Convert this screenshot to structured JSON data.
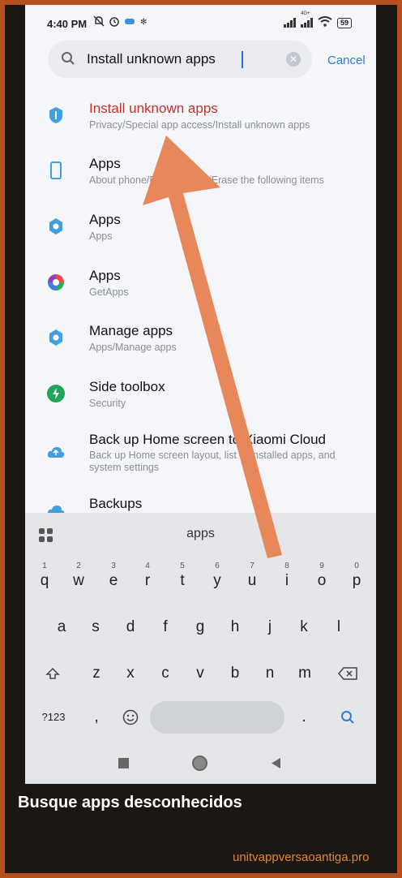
{
  "status_bar": {
    "time": "4:40 PM",
    "network_type": "4G+",
    "battery": "59"
  },
  "search": {
    "value": "Install unknown apps",
    "cancel_label": "Cancel"
  },
  "results": [
    {
      "title": "Install unknown apps",
      "subtitle": "Privacy/Special app access/Install unknown apps",
      "icon": "shield-icon",
      "color": "#3f9fe0"
    },
    {
      "title": "Apps",
      "subtitle": "About phone/Factory reset/Erase the following items",
      "icon": "phone-icon",
      "color": "#3f9fe0"
    },
    {
      "title": "Apps",
      "subtitle": "Apps",
      "icon": "gear-icon",
      "color": "#3f9fe0"
    },
    {
      "title": "Apps",
      "subtitle": "GetApps",
      "icon": "getapps-icon"
    },
    {
      "title": "Manage apps",
      "subtitle": "Apps/Manage apps",
      "icon": "gear-icon",
      "color": "#3f9fe0"
    },
    {
      "title": "Side toolbox",
      "subtitle": "Security",
      "icon": "security-icon",
      "color": "#22a45a"
    },
    {
      "title": "Back up Home screen to Xiaomi Cloud",
      "subtitle": "Back up Home screen layout, list of installed apps, and",
      "subtitle2": "system settings",
      "icon": "cloud-icon",
      "color": "#3f9fe0"
    },
    {
      "title": "Backups",
      "subtitle": "",
      "icon": "cloud-icon",
      "color": "#3f9fe0"
    }
  ],
  "keyboard": {
    "suggestion": "apps",
    "row1": [
      "q",
      "w",
      "e",
      "r",
      "t",
      "y",
      "u",
      "i",
      "o",
      "p"
    ],
    "row1_numbers": [
      "1",
      "2",
      "3",
      "4",
      "5",
      "6",
      "7",
      "8",
      "9",
      "0"
    ],
    "row2": [
      "a",
      "s",
      "d",
      "f",
      "g",
      "h",
      "j",
      "k",
      "l"
    ],
    "row3": [
      "z",
      "x",
      "c",
      "v",
      "b",
      "n",
      "m"
    ],
    "symbols_label": "?123",
    "comma": ",",
    "period": "."
  },
  "caption": "Busque apps desconhecidos",
  "watermark": "unitvappversaoantiga.pro",
  "colors": {
    "frame": "#b5501f",
    "arrow": "#e8875a",
    "accent": "#2f7bd6",
    "highlight_title": "#c53128"
  }
}
